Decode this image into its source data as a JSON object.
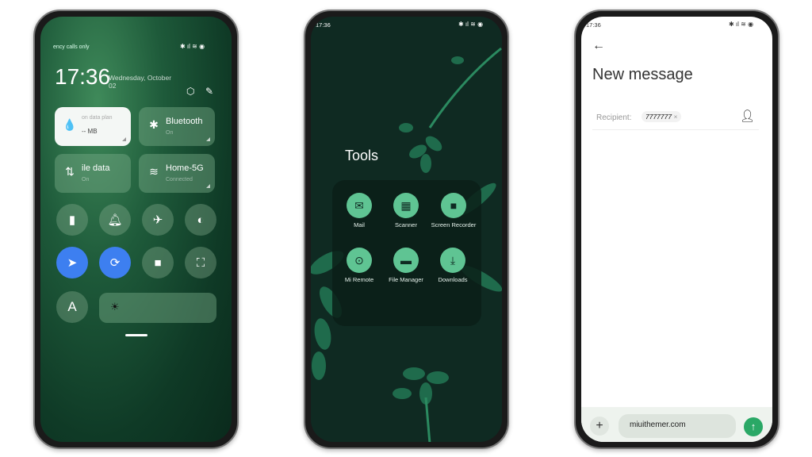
{
  "phone1": {
    "status_text": "ency calls only",
    "status_icons": [
      "bluetooth-icon",
      "signal-icon",
      "wifi-icon",
      "battery-icon"
    ],
    "clock": "17:36",
    "date": "Wednesday, October 02",
    "tiles": [
      {
        "title": "on data plan",
        "sub": "-- MB",
        "icon": "water-drop-icon",
        "active": true
      },
      {
        "title": "Bluetooth",
        "sub": "On",
        "icon": "bluetooth-icon"
      },
      {
        "title": "ile data",
        "sub": "On",
        "icon": "mobile-data-icon"
      },
      {
        "title": "Home-5G",
        "sub": "Connected",
        "icon": "wifi-icon"
      }
    ],
    "toggles": [
      "flashlight",
      "bell",
      "airplane",
      "dark-mode",
      "location",
      "rotation-lock",
      "screen-record",
      "scan"
    ],
    "auto_brightness_label": "A",
    "accent": "#3d7ff0"
  },
  "phone2": {
    "status_time": "17:36",
    "folder_title": "Tools",
    "apps": [
      {
        "label": "Mail",
        "icon": "mail-icon"
      },
      {
        "label": "Scanner",
        "icon": "qr-icon"
      },
      {
        "label": "Screen Recorder",
        "icon": "video-camera-icon"
      },
      {
        "label": "Mi Remote",
        "icon": "remote-icon"
      },
      {
        "label": "File Manager",
        "icon": "folder-icon"
      },
      {
        "label": "Downloads",
        "icon": "download-icon"
      }
    ],
    "accent": "#5fc493"
  },
  "phone3": {
    "status_time": "17:36",
    "title": "New message",
    "recipient_label": "Recipient:",
    "recipient_chip": "7777777",
    "message_value": "miuithemer.com",
    "send_color": "#2aa866"
  }
}
